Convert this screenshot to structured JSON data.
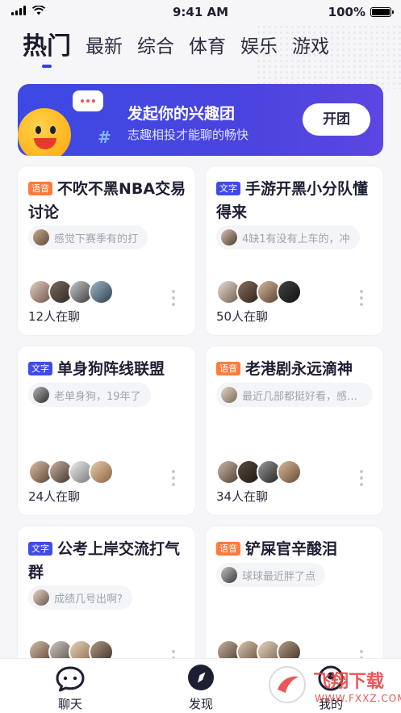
{
  "status_bar": {
    "time": "9:41 AM",
    "battery": "100%"
  },
  "tabs": [
    {
      "label": "热门",
      "active": true
    },
    {
      "label": "最新"
    },
    {
      "label": "综合"
    },
    {
      "label": "体育"
    },
    {
      "label": "娱乐"
    },
    {
      "label": "游戏"
    }
  ],
  "banner": {
    "title": "发起你的兴趣团",
    "subtitle": "志趣相投才能聊的畅快",
    "button": "开团"
  },
  "tag_labels": {
    "voice": "语音",
    "text": "文字"
  },
  "cards": [
    {
      "tag": "语音",
      "tag_type": "voice",
      "title": "不吹不黑NBA交易讨论",
      "last_message": "感觉下赛季有的打",
      "count": "12人在聊"
    },
    {
      "tag": "文字",
      "tag_type": "text",
      "title": "手游开黑小分队懂得来",
      "last_message": "4缺1有没有上车的，冲",
      "count": "50人在聊"
    },
    {
      "tag": "文字",
      "tag_type": "text",
      "title": "单身狗阵线联盟",
      "last_message": "老单身狗，19年了",
      "count": "24人在聊"
    },
    {
      "tag": "语音",
      "tag_type": "voice",
      "title": "老港剧永远滴神",
      "last_message": "最近几部都挺好看，感觉...",
      "count": "34人在聊"
    },
    {
      "tag": "文字",
      "tag_type": "text",
      "title": "公考上岸交流打气群",
      "last_message": "成绩几号出啊?",
      "count": ""
    },
    {
      "tag": "语音",
      "tag_type": "voice",
      "title": "铲屎官辛酸泪",
      "last_message": "球球最近胖了点",
      "count": ""
    }
  ],
  "tabbar": [
    {
      "label": "聊天",
      "icon": "chat-bubble-icon"
    },
    {
      "label": "发现",
      "icon": "compass-icon",
      "active": true
    },
    {
      "label": "我的",
      "icon": "profile-icon"
    }
  ],
  "watermark": {
    "text": "飞翔下载",
    "url": "WWW.FXXZ.COM"
  },
  "colors": {
    "accent": "#3b3fd8",
    "voice_tag": "#ff7a3d",
    "text_tag": "#3f4be8",
    "banner": "#4046e0"
  }
}
